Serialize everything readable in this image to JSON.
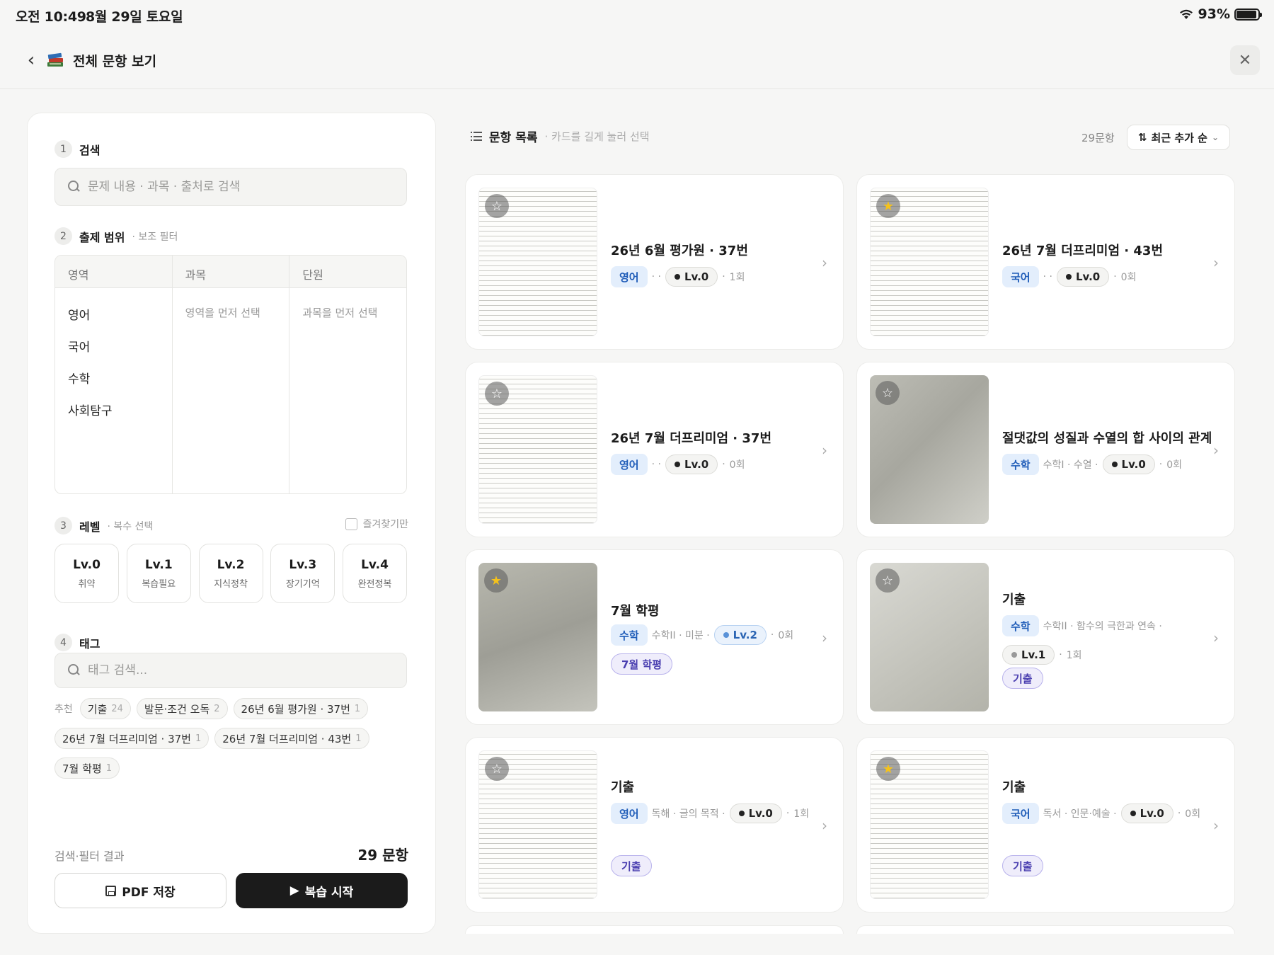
{
  "status": {
    "time": "오전 10:49",
    "date": "8월 29일 토요일",
    "battery": "93%",
    "battery_level": 0.93
  },
  "header": {
    "title": "전체 문항 보기",
    "back_icon": "chevron-left-icon",
    "close_icon": "close-icon"
  },
  "filter": {
    "search": {
      "num": "1",
      "title": "검색",
      "placeholder": "문제 내용 · 과목 · 출처로 검색"
    },
    "scope": {
      "num": "2",
      "title": "출제 범위",
      "sub": "· 보조 필터",
      "columns": [
        "영역",
        "과목",
        "단원"
      ],
      "areas": [
        "영어",
        "국어",
        "수학",
        "사회탐구"
      ],
      "subject_hint": "영역을 먼저 선택",
      "unit_hint": "과목을 먼저 선택"
    },
    "level": {
      "num": "3",
      "title": "레벨",
      "sub": "· 복수 선택",
      "favorites": "즐겨찾기만",
      "items": [
        {
          "name": "Lv.0",
          "desc": "취약"
        },
        {
          "name": "Lv.1",
          "desc": "복습필요"
        },
        {
          "name": "Lv.2",
          "desc": "지식정착"
        },
        {
          "name": "Lv.3",
          "desc": "장기기억"
        },
        {
          "name": "Lv.4",
          "desc": "완전정복"
        }
      ]
    },
    "tags": {
      "num": "4",
      "title": "태그",
      "placeholder": "태그 검색...",
      "rec_label": "추천",
      "items": [
        {
          "name": "기출",
          "count": "24"
        },
        {
          "name": "발문·조건 오독",
          "count": "2"
        },
        {
          "name": "26년 6월 평가원 · 37번",
          "count": "1"
        },
        {
          "name": "26년 7월 더프리미엄 · 37번",
          "count": "1"
        },
        {
          "name": "26년 7월 더프리미엄 · 43번",
          "count": "1"
        },
        {
          "name": "7월 학평",
          "count": "1"
        }
      ]
    },
    "result_label": "검색·필터 결과",
    "result_count": "29 문항",
    "pdf_button": "PDF 저장",
    "review_button": "복습 시작"
  },
  "list": {
    "title": "문항 목록",
    "sub": "· 카드를 길게 눌러 선택",
    "count": "29문항",
    "sort": "최근 추가 순",
    "cards": [
      {
        "title": "26년 6월 평가원 · 37번",
        "subject": "영어",
        "detail": "·  ·",
        "level": "Lv.0",
        "times": "1회",
        "tag": "",
        "star": false
      },
      {
        "title": "26년 7월 더프리미엄 · 43번",
        "subject": "국어",
        "detail": "·  ·",
        "level": "Lv.0",
        "times": "0회",
        "tag": "",
        "star": true
      },
      {
        "title": "26년 7월 더프리미엄 · 37번",
        "subject": "영어",
        "detail": "·  ·",
        "level": "Lv.0",
        "times": "0회",
        "tag": "",
        "star": false
      },
      {
        "title": "절댓값의 성질과 수열의 합 사이의 관계",
        "subject": "수학",
        "detail": "수학I · 수열 ·",
        "level": "Lv.0",
        "times": "0회",
        "tag": "",
        "star": false
      },
      {
        "title": "7월 학평",
        "subject": "수학",
        "detail": "수학II · 미분 ·",
        "level": "Lv.2",
        "times": "0회",
        "tag": "7월 학평",
        "star": true
      },
      {
        "title": "기출",
        "subject": "수학",
        "detail": "수학II · 함수의 극한과 연속 ·",
        "level": "Lv.1",
        "times": "1회",
        "tag": "기출",
        "star": false
      },
      {
        "title": "기출",
        "subject": "영어",
        "detail": "독해 · 글의 목적 ·",
        "level": "Lv.0",
        "times": "1회",
        "tag": "기출",
        "star": false
      },
      {
        "title": "기출",
        "subject": "국어",
        "detail": "독서 · 인문·예술 ·",
        "level": "Lv.0",
        "times": "0회",
        "tag": "기출",
        "star": true
      }
    ]
  }
}
